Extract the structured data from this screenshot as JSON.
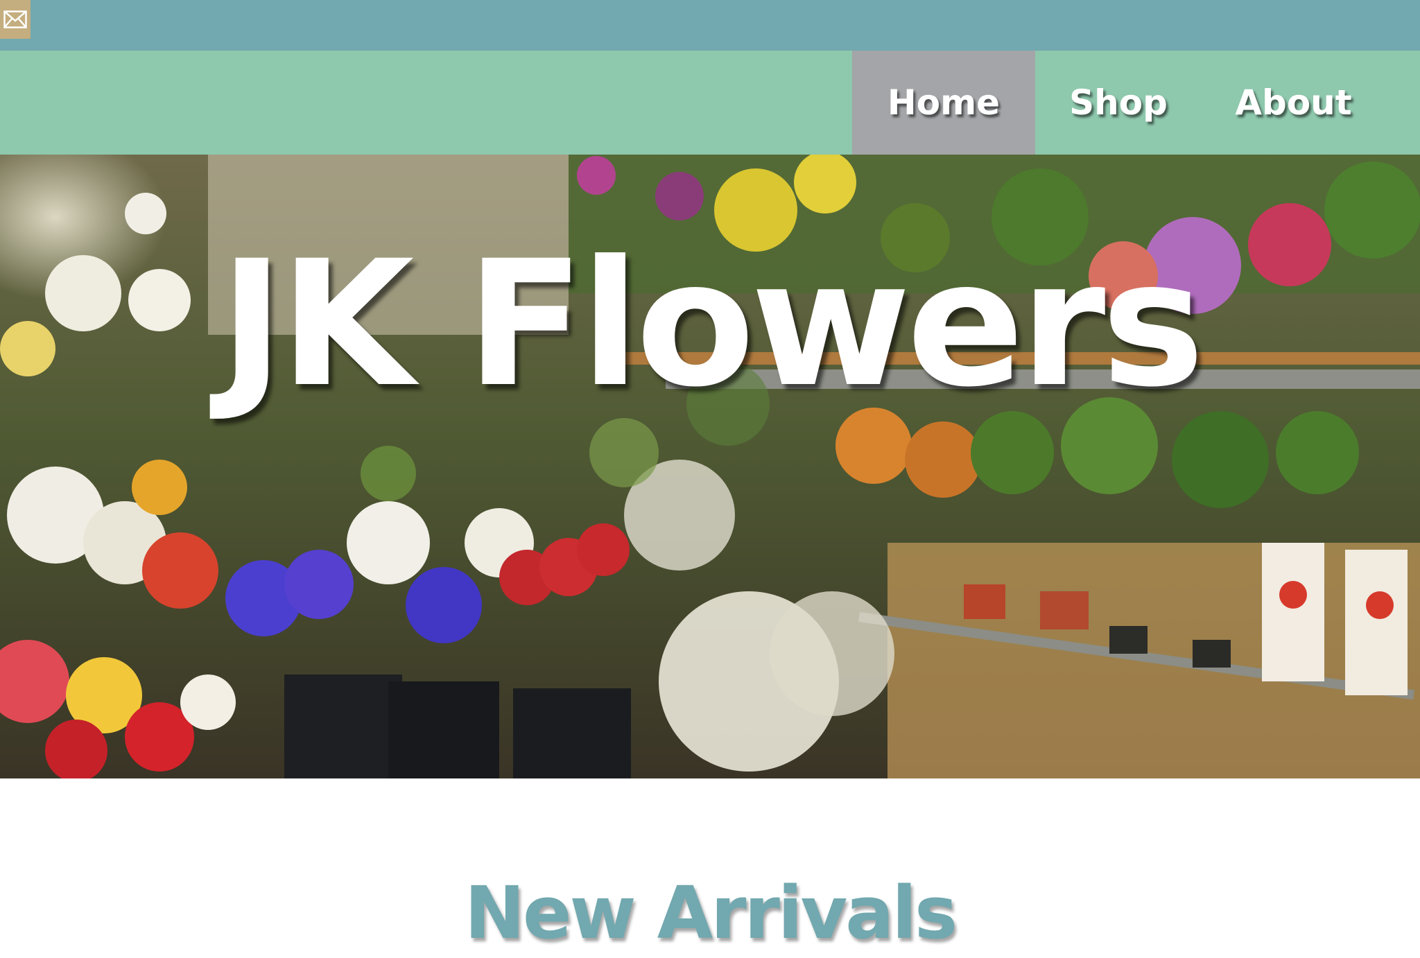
{
  "topbar": {
    "icon": "mail-icon",
    "color": "#72a8af",
    "icon_bg": "#c4ad7e"
  },
  "nav": {
    "background": "#8ec8ad",
    "active_background": "#a4a5a8",
    "items": [
      {
        "label": "Home",
        "active": true
      },
      {
        "label": "Shop",
        "active": false
      },
      {
        "label": "About",
        "active": false
      }
    ]
  },
  "hero": {
    "title": "JK Flowers",
    "image": "flower-shop-interior-photo"
  },
  "main": {
    "section_title": "New Arrivals",
    "section_color": "#72a8af"
  }
}
